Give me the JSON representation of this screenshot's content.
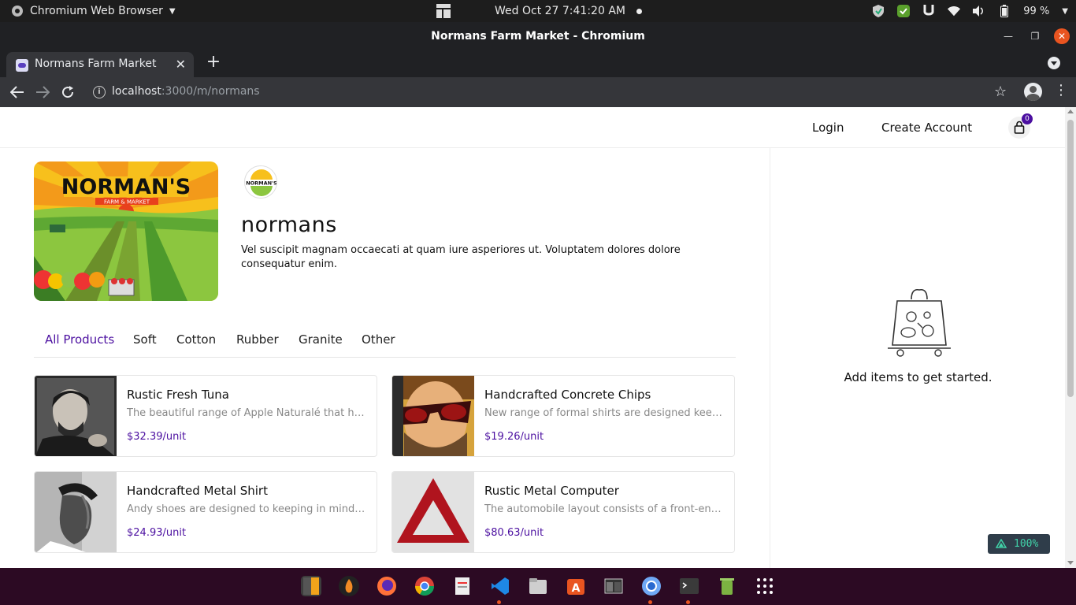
{
  "system_bar": {
    "app_name": "Chromium Web Browser",
    "datetime": "Wed Oct 27  7:41:20 AM",
    "battery": "99 %"
  },
  "window": {
    "title": "Normans Farm Market - Chromium",
    "tab_title": "Normans Farm Market",
    "url_host": "localhost",
    "url_path": ":3000/m/normans"
  },
  "header": {
    "login": "Login",
    "create_account": "Create Account",
    "cart_count": "0"
  },
  "market": {
    "name": "normans",
    "description": "Vel suscipit magnam occaecati at quam iure asperiores ut. Voluptatem dolores dolore consequatur enim.",
    "banner_title": "NORMAN'S",
    "banner_subtitle": "FARM & MARKET",
    "logo_text": "NORMAN'S"
  },
  "tabs": [
    "All Products",
    "Soft",
    "Cotton",
    "Rubber",
    "Granite",
    "Other"
  ],
  "products": [
    {
      "name": "Rustic Fresh Tuna",
      "desc": "The beautiful range of Apple Naturalé that has ...",
      "price": "$32.39/unit"
    },
    {
      "name": "Handcrafted Concrete Chips",
      "desc": "New range of formal shirts are designed keepi...",
      "price": "$19.26/unit"
    },
    {
      "name": "Handcrafted Metal Shirt",
      "desc": "Andy shoes are designed to keeping in mind d...",
      "price": "$24.93/unit"
    },
    {
      "name": "Rustic Metal Computer",
      "desc": "The automobile layout consists of a front-engi...",
      "price": "$80.63/unit"
    }
  ],
  "cart": {
    "empty_text": "Add items to get started."
  },
  "devtools": {
    "zoom": "100%"
  },
  "colors": {
    "accent": "#4b0fa0",
    "dock": "#2c0a23",
    "browser_dark": "#202124"
  }
}
